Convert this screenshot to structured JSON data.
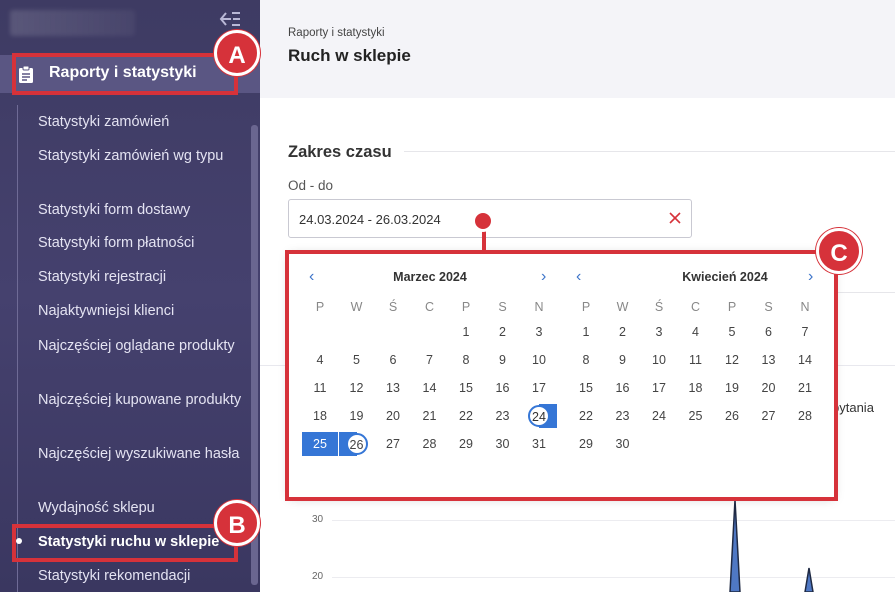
{
  "sidebar": {
    "section_label": "Raporty i statystyki",
    "items": [
      {
        "label": "Statystyki zamówień"
      },
      {
        "label": "Statystyki zamówień wg typu"
      },
      {
        "label": "Statystyki form dostawy"
      },
      {
        "label": "Statystyki form płatności"
      },
      {
        "label": "Statystyki rejestracji"
      },
      {
        "label": "Najaktywniejsi klienci"
      },
      {
        "label": "Najczęściej oglądane produkty"
      },
      {
        "label": "Najczęściej kupowane produkty"
      },
      {
        "label": "Najczęściej wyszukiwane hasła"
      },
      {
        "label": "Wydajność sklepu"
      },
      {
        "label": "Statystyki ruchu w sklepie"
      },
      {
        "label": "Statystyki rekomendacji"
      }
    ]
  },
  "header": {
    "breadcrumb": "Raporty i statystyki",
    "title": "Ruch w sklepie"
  },
  "filter": {
    "section_title": "Zakres czasu",
    "range_label": "Od - do",
    "range_value": "24.03.2024 - 26.03.2024"
  },
  "calendar": {
    "nav_prev": "‹",
    "nav_next": "›",
    "weekdays": [
      "P",
      "W",
      "Ś",
      "C",
      "P",
      "S",
      "N"
    ],
    "months": [
      {
        "title": "Marzec 2024",
        "days": [
          "1",
          "2",
          "3",
          "4",
          "5",
          "6",
          "7",
          "8",
          "9",
          "10",
          "11",
          "12",
          "13",
          "14",
          "15",
          "16",
          "17",
          "18",
          "19",
          "20",
          "21",
          "22",
          "23",
          "24",
          "25",
          "26",
          "27",
          "28",
          "29",
          "30",
          "31"
        ]
      },
      {
        "title": "Kwiecień 2024",
        "days": [
          "1",
          "2",
          "3",
          "4",
          "5",
          "6",
          "7",
          "8",
          "9",
          "10",
          "11",
          "12",
          "13",
          "14",
          "15",
          "16",
          "17",
          "18",
          "19",
          "20",
          "21",
          "22",
          "23",
          "24",
          "25",
          "26",
          "27",
          "28",
          "29",
          "30"
        ]
      }
    ]
  },
  "fragments": {
    "partial_label": "pytania",
    "chart_ticks": [
      "30",
      "20"
    ]
  },
  "annotations": {
    "a": "A",
    "b": "B",
    "c": "C"
  },
  "colors": {
    "accent": "#3576d6",
    "annotation": "#d6323a",
    "sidebar": "#423f6a"
  }
}
